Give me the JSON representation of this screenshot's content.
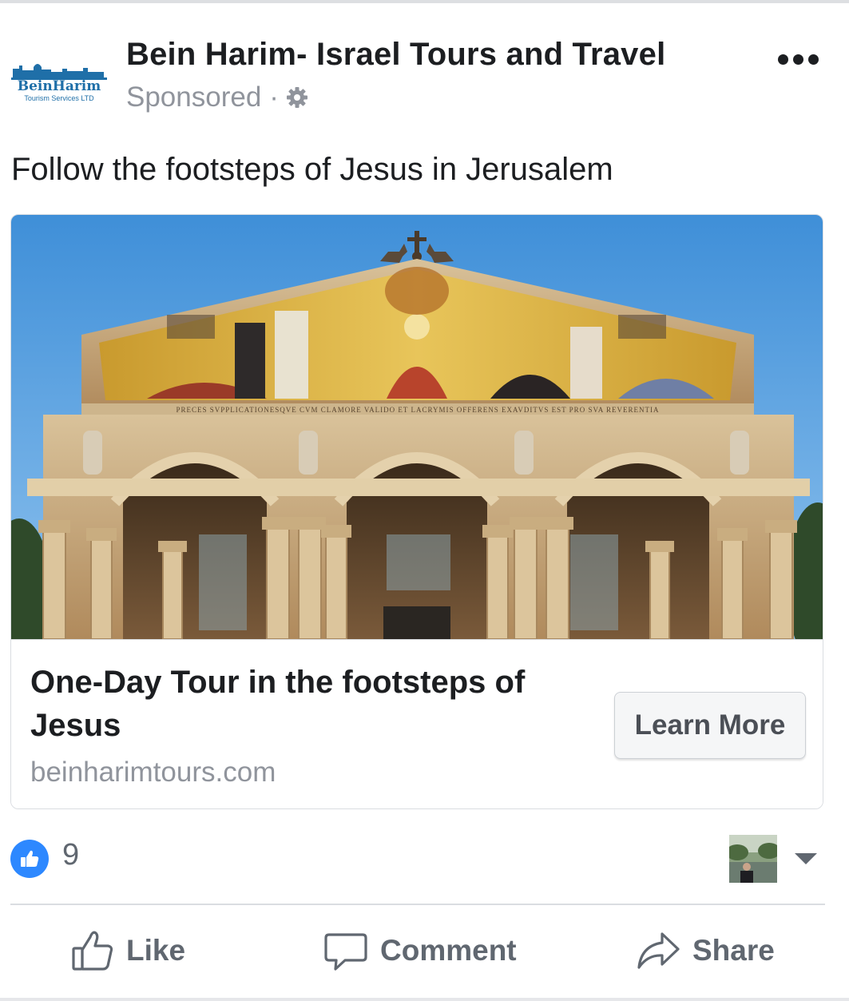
{
  "post": {
    "page_name": "Bein Harim- Israel Tours and Travel",
    "sponsored_label": "Sponsored",
    "separator": "·",
    "logo": {
      "brand": "BeinHarim",
      "tagline": "Tourism Services LTD"
    },
    "message": "Follow the footsteps of Jesus in Jerusalem"
  },
  "link_card": {
    "image": {
      "description": "Church of All Nations facade",
      "mosaic_inscription": "PRECES SVPPLICATIONESQVE CVM CLAMORE VALIDO ET LACRYMIS OFFERENS EXAVDITVS EST PRO SVA REVERENTIA"
    },
    "title": "One-Day Tour in the footsteps of Jesus",
    "domain": "beinharimtours.com",
    "cta_label": "Learn More"
  },
  "reactions": {
    "count": "9",
    "icon": "thumbs-up-icon"
  },
  "actions": {
    "like": "Like",
    "comment": "Comment",
    "share": "Share"
  },
  "colors": {
    "facebook_blue": "#2d88ff",
    "text_gray": "#606770",
    "meta_gray": "#90949c"
  }
}
